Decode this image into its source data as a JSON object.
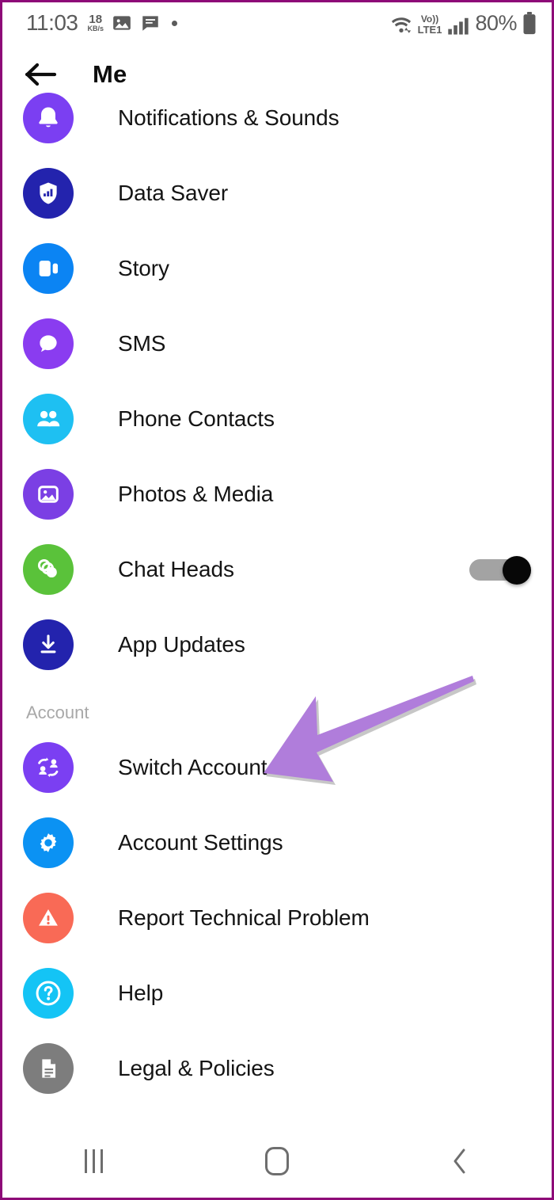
{
  "status_bar": {
    "time": "11:03",
    "net_speed_value": "18",
    "net_speed_unit": "KB/s",
    "photo_icon": "image-icon",
    "message_icon": "message-icon",
    "dot_icon": "more-dot-icon",
    "wifi_icon": "wifi-icon",
    "volte_top": "Vo))",
    "volte_bottom": "LTE1",
    "signal_icon": "signal-bars-icon",
    "battery_percent": "80%",
    "battery_icon": "battery-icon"
  },
  "app_bar": {
    "back_icon": "back-arrow-icon",
    "title": "Me"
  },
  "list": [
    {
      "label": "Notifications & Sounds",
      "icon": "bell-icon",
      "color": "#7b3ff2",
      "toggle": null
    },
    {
      "label": "Data Saver",
      "icon": "shield-icon",
      "color": "#2323ad",
      "toggle": null
    },
    {
      "label": "Story",
      "icon": "story-icon",
      "color": "#0b84f3",
      "toggle": null
    },
    {
      "label": "SMS",
      "icon": "chat-bubble-icon",
      "color": "#8a3cf0",
      "toggle": null
    },
    {
      "label": "Phone Contacts",
      "icon": "people-icon",
      "color": "#1ec0f2",
      "toggle": null
    },
    {
      "label": "Photos & Media",
      "icon": "photo-icon",
      "color": "#7b3fe4",
      "toggle": null
    },
    {
      "label": "Chat Heads",
      "icon": "chat-heads-icon",
      "color": "#5ac23a",
      "toggle": "on"
    },
    {
      "label": "App Updates",
      "icon": "download-icon",
      "color": "#2323ad",
      "toggle": null
    }
  ],
  "account_section": {
    "header": "Account",
    "items": [
      {
        "label": "Switch Account",
        "icon": "switch-account-icon",
        "color": "#7b3ff2"
      },
      {
        "label": "Account Settings",
        "icon": "gear-icon",
        "color": "#0b92f3"
      },
      {
        "label": "Report Technical Problem",
        "icon": "warning-icon",
        "color": "#f96a56"
      },
      {
        "label": "Help",
        "icon": "question-icon",
        "color": "#14c4f5"
      },
      {
        "label": "Legal & Policies",
        "icon": "document-icon",
        "color": "#7d7d7d"
      }
    ]
  },
  "annotation": {
    "arrow_icon": "pointer-arrow-icon",
    "arrow_color": "#b07ddb",
    "points_to": "Switch Account"
  },
  "nav_bar": {
    "recents_icon": "recents-icon",
    "home_icon": "home-icon",
    "back_icon": "nav-back-icon"
  },
  "theme": {
    "frame_border": "#8d0a78",
    "background": "#ffffff",
    "text_primary": "#141414",
    "text_muted": "#a8a8a8",
    "toggle_track": "#a3a3a3",
    "toggle_knob": "#070707"
  }
}
